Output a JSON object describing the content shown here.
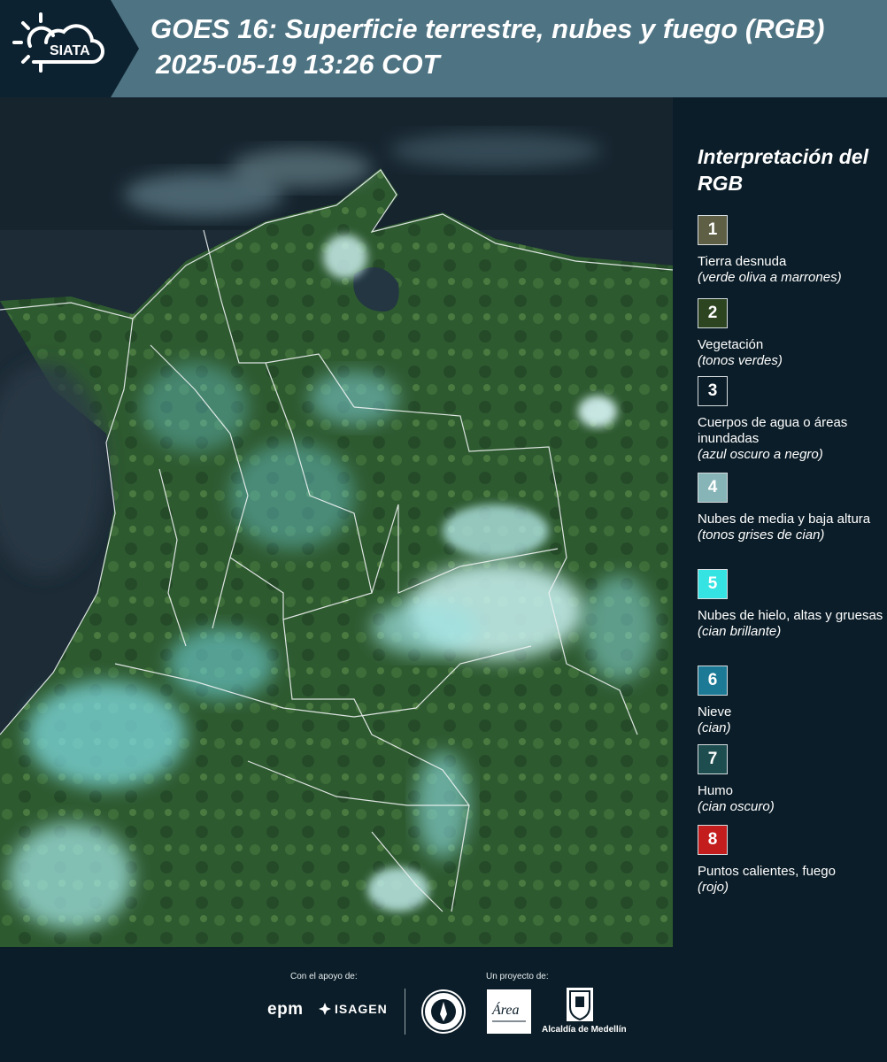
{
  "header": {
    "logo_text": "SIATA",
    "title": "GOES 16: Superficie terrestre, nubes y fuego (RGB)",
    "subtitle": "2025-05-19 13:26 COT"
  },
  "legend": {
    "title": "Interpretación del RGB",
    "items": [
      {
        "number": "1",
        "label": "Tierra desnuda",
        "note": "(verde oliva a marrones)",
        "color": "#5f5f45"
      },
      {
        "number": "2",
        "label": "Vegetación",
        "note": "(tonos verdes)",
        "color": "#2c4420"
      },
      {
        "number": "3",
        "label": "Cuerpos de agua o áreas inundadas",
        "note": "(azul oscuro a negro)",
        "color": "#0b1d28"
      },
      {
        "number": "4",
        "label": "Nubes de media y baja altura",
        "note": "(tonos grises de cian)",
        "color": "#86b4b7"
      },
      {
        "number": "5",
        "label": "Nubes de hielo, altas y gruesas",
        "note": "(cian brillante)",
        "color": "#35e3e3"
      },
      {
        "number": "6",
        "label": "Nieve",
        "note": "(cian)",
        "color": "#1c7a96"
      },
      {
        "number": "7",
        "label": "Humo",
        "note": "(cian oscuro)",
        "color": "#1e4d50"
      },
      {
        "number": "8",
        "label": "Puntos calientes, fuego",
        "note": "(rojo)",
        "color": "#c41d1d"
      }
    ]
  },
  "footer": {
    "support_label": "Con el apoyo de:",
    "project_label": "Un proyecto de:",
    "sponsor_1": "epm",
    "sponsor_2": "ISAGEN",
    "partner_area": "Área",
    "partner_alcaldia": "Alcaldía de Medellín"
  }
}
